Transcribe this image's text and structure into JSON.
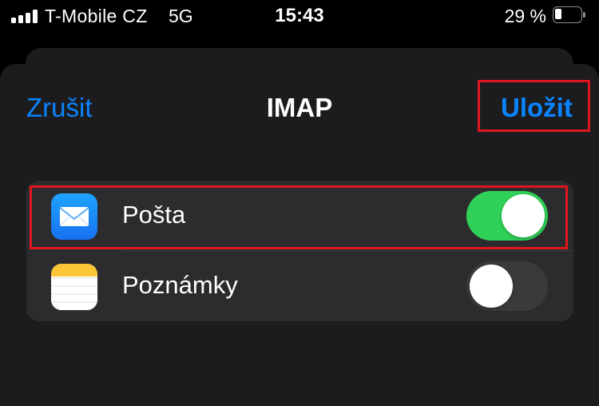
{
  "status_bar": {
    "carrier": "T-Mobile CZ",
    "network": "5G",
    "time": "15:43",
    "battery_percent": "29 %",
    "battery_level": 0.29,
    "signal_bars": 4
  },
  "sheet": {
    "title": "IMAP",
    "cancel_label": "Zrušit",
    "save_label": "Uložit"
  },
  "list": {
    "items": [
      {
        "label": "Pošta",
        "icon": "mail-icon",
        "enabled": true
      },
      {
        "label": "Poznámky",
        "icon": "notes-icon",
        "enabled": false
      }
    ]
  },
  "colors": {
    "accent": "#0a84ff",
    "toggle_on": "#30d158",
    "toggle_off": "#3a3a3c",
    "highlight": "#e0161f",
    "sheet_background": "#1c1c1e",
    "list_background": "#2c2c2e"
  }
}
